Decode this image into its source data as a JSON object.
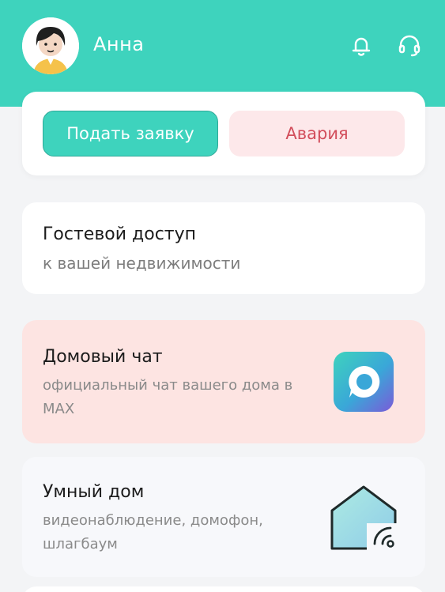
{
  "header": {
    "user_name": "Анна",
    "icons": [
      "bell-icon",
      "support-headset-icon"
    ],
    "accent": "#3ed3bd"
  },
  "actions": {
    "request_label": "Подать заявку",
    "emergency_label": "Авария"
  },
  "cards": {
    "guest": {
      "title": "Гостевой доступ",
      "subtitle": "к вашей недвижимости"
    },
    "chat": {
      "title": "Домовый чат",
      "subtitle": "официальный чат вашего дома в MAX",
      "icon": "max-messenger-icon"
    },
    "smart": {
      "title": "Умный дом",
      "subtitle": "видеонаблюдение, домофон, шлагбаум",
      "icon": "smart-home-icon"
    }
  }
}
